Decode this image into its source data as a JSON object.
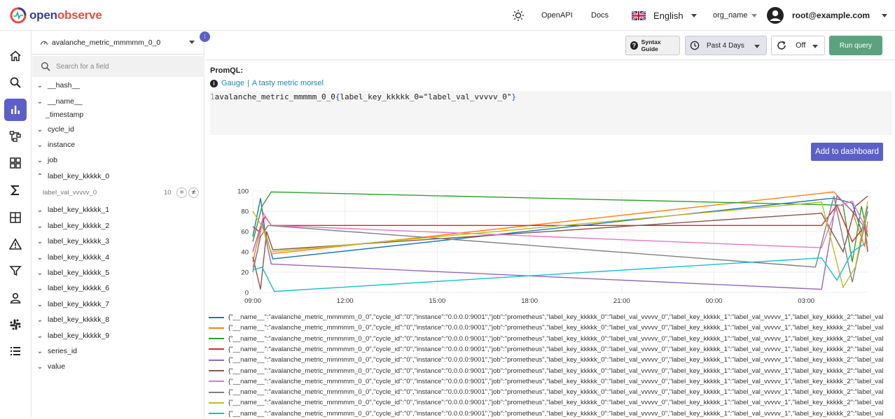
{
  "header": {
    "logo_text_a": "open",
    "logo_text_b": "observe",
    "links": [
      "OpenAPI",
      "Docs"
    ],
    "language": "English",
    "org": "org_name",
    "user_email": "root@example.com"
  },
  "nav": {
    "items": [
      "home",
      "search",
      "metrics",
      "traces",
      "dashboards",
      "functions",
      "streams",
      "alerts",
      "ingestion",
      "iam",
      "slack",
      "about"
    ],
    "active": "metrics",
    "accent": "#5b5fc7"
  },
  "fields_panel": {
    "stream": "avalanche_metric_mmmmm_0_0",
    "search_placeholder": "Search for a field",
    "fields": [
      {
        "name": "__hash__",
        "expandable": true
      },
      {
        "name": "__name__",
        "expandable": true
      },
      {
        "name": "_timestamp",
        "expandable": false
      },
      {
        "name": "cycle_id",
        "expandable": true
      },
      {
        "name": "instance",
        "expandable": true
      },
      {
        "name": "job",
        "expandable": true
      },
      {
        "name": "label_key_kkkkk_0",
        "expandable": true,
        "expanded": true
      },
      {
        "name": "label_key_kkkkk_1",
        "expandable": true
      },
      {
        "name": "label_key_kkkkk_2",
        "expandable": true
      },
      {
        "name": "label_key_kkkkk_3",
        "expandable": true
      },
      {
        "name": "label_key_kkkkk_4",
        "expandable": true
      },
      {
        "name": "label_key_kkkkk_5",
        "expandable": true
      },
      {
        "name": "label_key_kkkkk_6",
        "expandable": true
      },
      {
        "name": "label_key_kkkkk_7",
        "expandable": true
      },
      {
        "name": "label_key_kkkkk_8",
        "expandable": true
      },
      {
        "name": "label_key_kkkkk_9",
        "expandable": true
      },
      {
        "name": "series_id",
        "expandable": true
      },
      {
        "name": "value",
        "expandable": true
      }
    ],
    "expanded_value": {
      "value": "label_val_vvvvv_0",
      "count": "10",
      "eq": "=",
      "neq": "≠"
    }
  },
  "toolbar": {
    "syntax_guide": "Syntax Guide",
    "time_range": "Past 4 Days",
    "refresh": "Off",
    "run_query": "Run query",
    "run_color": "#5ba37e"
  },
  "query": {
    "label": "PromQL:",
    "metric_type": "Gauge",
    "metric_help": "A tasty metric morsel",
    "line_number": "1",
    "metric_name": "avalanche_metric_mmmmm_0_0",
    "open_brace": "{",
    "matcher": "label_key_kkkkk_0=\"label_val_vvvvv_0\"",
    "close_brace": "}"
  },
  "add_to_dashboard": "Add to dashboard",
  "chart_data": {
    "type": "line",
    "y_ticks": [
      "0",
      "20",
      "40",
      "60",
      "80",
      "100"
    ],
    "ylim": [
      0,
      100
    ],
    "x_ticks": [
      "09:00",
      "12:00",
      "15:00",
      "18:00",
      "21:00",
      "00:00",
      "03:00"
    ],
    "grid": true,
    "legend_position": "bottom",
    "series": [
      {
        "name": "{\"__name__\":\"avalanche_metric_mmmmm_0_0\",\"cycle_id\":\"0\",\"instance\":\"0.0.0.0:9001\",\"job\":\"prometheus\",\"label_key_kkkkk_0\":\"label_val_vvvvv_0\",\"label_key_kkkkk_1\":\"label_val_vvvvv_1\",\"label_key_kkkkk_2\":\"label_val",
        "color": "#1f77b4",
        "points": [
          [
            0,
            55
          ],
          [
            0.1,
            70
          ],
          [
            0.25,
            93
          ],
          [
            0.4,
            60
          ],
          [
            0.65,
            33
          ],
          [
            18.9,
            93
          ],
          [
            19.5,
            88
          ],
          [
            19.8,
            60
          ],
          [
            20,
            85
          ]
        ]
      },
      {
        "name": "{\"__name__\":\"avalanche_metric_mmmmm_0_0\",\"cycle_id\":\"0\",\"instance\":\"0.0.0.0:9001\",\"job\":\"prometheus\",\"label_key_kkkkk_0\":\"label_val_vvvvv_0\",\"label_key_kkkkk_1\":\"label_val_vvvvv_1\",\"label_key_kkkkk_2\":\"label_val",
        "color": "#ff7f0e",
        "points": [
          [
            0,
            30
          ],
          [
            0.3,
            70
          ],
          [
            0.6,
            38
          ],
          [
            18.9,
            99
          ],
          [
            19.5,
            80
          ],
          [
            19.9,
            45
          ],
          [
            20,
            70
          ]
        ]
      },
      {
        "name": "{\"__name__\":\"avalanche_metric_mmmmm_0_0\",\"cycle_id\":\"0\",\"instance\":\"0.0.0.0:9001\",\"job\":\"prometheus\",\"label_key_kkkkk_0\":\"label_val_vvvvv_0\",\"label_key_kkkkk_1\":\"label_val_vvvvv_1\",\"label_key_kkkkk_2\":\"label_val",
        "color": "#2ca02c",
        "points": [
          [
            0,
            50
          ],
          [
            0.3,
            85
          ],
          [
            0.6,
            99
          ],
          [
            19.2,
            86
          ],
          [
            19.5,
            30
          ],
          [
            19.8,
            85
          ],
          [
            20,
            55
          ]
        ]
      },
      {
        "name": "{\"__name__\":\"avalanche_metric_mmmmm_0_0\",\"cycle_id\":\"0\",\"instance\":\"0.0.0.0:9001\",\"job\":\"prometheus\",\"label_key_kkkkk_0\":\"label_val_vvvvv_0\",\"label_key_kkkkk_1\":\"label_val_vvvvv_1\",\"label_key_kkkkk_2\":\"label_val",
        "color": "#d62728",
        "points": [
          [
            0,
            65
          ],
          [
            0.2,
            60
          ],
          [
            0.4,
            75
          ],
          [
            0.6,
            66
          ],
          [
            18.5,
            66
          ],
          [
            19,
            86
          ],
          [
            19.5,
            50
          ],
          [
            19.9,
            65
          ],
          [
            20,
            40
          ]
        ]
      },
      {
        "name": "{\"__name__\":\"avalanche_metric_mmmmm_0_0\",\"cycle_id\":\"0\",\"instance\":\"0.0.0.0:9001\",\"job\":\"prometheus\",\"label_key_kkkkk_0\":\"label_val_vvvvv_0\",\"label_key_kkkkk_1\":\"label_val_vvvvv_1\",\"label_key_kkkkk_2\":\"label_val",
        "color": "#9467bd",
        "points": [
          [
            0,
            40
          ],
          [
            0.3,
            70
          ],
          [
            0.6,
            28
          ],
          [
            18.5,
            3
          ],
          [
            19,
            95
          ],
          [
            19.5,
            80
          ],
          [
            20,
            60
          ]
        ]
      },
      {
        "name": "{\"__name__\":\"avalanche_metric_mmmmm_0_0\",\"cycle_id\":\"0\",\"instance\":\"0.0.0.0:9001\",\"job\":\"prometheus\",\"label_key_kkkkk_0\":\"label_val_vvvvv_0\",\"label_key_kkkkk_1\":\"label_val_vvvvv_1\",\"label_key_kkkkk_2\":\"label_val",
        "color": "#8c564b",
        "points": [
          [
            0,
            35
          ],
          [
            0.25,
            3
          ],
          [
            0.45,
            60
          ],
          [
            0.65,
            42
          ],
          [
            18.5,
            78
          ],
          [
            19.2,
            40
          ],
          [
            19.6,
            85
          ],
          [
            20,
            95
          ]
        ]
      },
      {
        "name": "{\"__name__\":\"avalanche_metric_mmmmm_0_0\",\"cycle_id\":\"0\",\"instance\":\"0.0.0.0:9001\",\"job\":\"prometheus\",\"label_key_kkkkk_0\":\"label_val_vvvvv_0\",\"label_key_kkkkk_1\":\"label_val_vvvvv_1\",\"label_key_kkkkk_2\":\"label_val",
        "color": "#e377c2",
        "points": [
          [
            0,
            25
          ],
          [
            0.15,
            40
          ],
          [
            0.35,
            78
          ],
          [
            0.6,
            66
          ],
          [
            18.5,
            44
          ],
          [
            19,
            85
          ],
          [
            19.5,
            90
          ],
          [
            20,
            60
          ]
        ]
      },
      {
        "name": "{\"__name__\":\"avalanche_metric_mmmmm_0_0\",\"cycle_id\":\"0\",\"instance\":\"0.0.0.0:9001\",\"job\":\"prometheus\",\"label_key_kkkkk_0\":\"label_val_vvvvv_0\",\"label_key_kkkkk_1\":\"label_val_vvvvv_1\",\"label_key_kkkkk_2\":\"label_val",
        "color": "#7f7f7f",
        "points": [
          [
            0,
            20
          ],
          [
            0.25,
            55
          ],
          [
            0.5,
            66
          ],
          [
            18.3,
            25
          ],
          [
            18.9,
            95
          ],
          [
            19.5,
            10
          ],
          [
            20,
            80
          ]
        ]
      },
      {
        "name": "{\"__name__\":\"avalanche_metric_mmmmm_0_0\",\"cycle_id\":\"0\",\"instance\":\"0.0.0.0:9001\",\"job\":\"prometheus\",\"label_key_kkkkk_0\":\"label_val_vvvvv_0\",\"label_key_kkkkk_1\":\"label_val_vvvvv_1\",\"label_key_kkkkk_2\":\"label_val",
        "color": "#bcbd22",
        "points": [
          [
            0,
            80
          ],
          [
            0.3,
            65
          ],
          [
            0.6,
            40
          ],
          [
            18.5,
            89
          ],
          [
            19.2,
            5
          ],
          [
            19.6,
            25
          ],
          [
            20,
            90
          ]
        ]
      },
      {
        "name": "{\"__name__\":\"avalanche_metric_mmmmm_0_0\",\"cycle_id\":\"0\",\"instance\":\"0.0.0.0:9001\",\"job\":\"prometheus\",\"label_key_kkkkk_0\":\"label_val_vvvvv_0\",\"label_key_kkkkk_1\":\"label_val_vvvvv_1\",\"label_key_kkkkk_2\":\"label_val",
        "color": "#17becf",
        "points": [
          [
            0,
            22
          ],
          [
            0.3,
            25
          ],
          [
            0.7,
            1
          ],
          [
            18.5,
            34
          ],
          [
            19,
            12
          ],
          [
            19.5,
            40
          ],
          [
            20,
            50
          ]
        ]
      }
    ]
  }
}
